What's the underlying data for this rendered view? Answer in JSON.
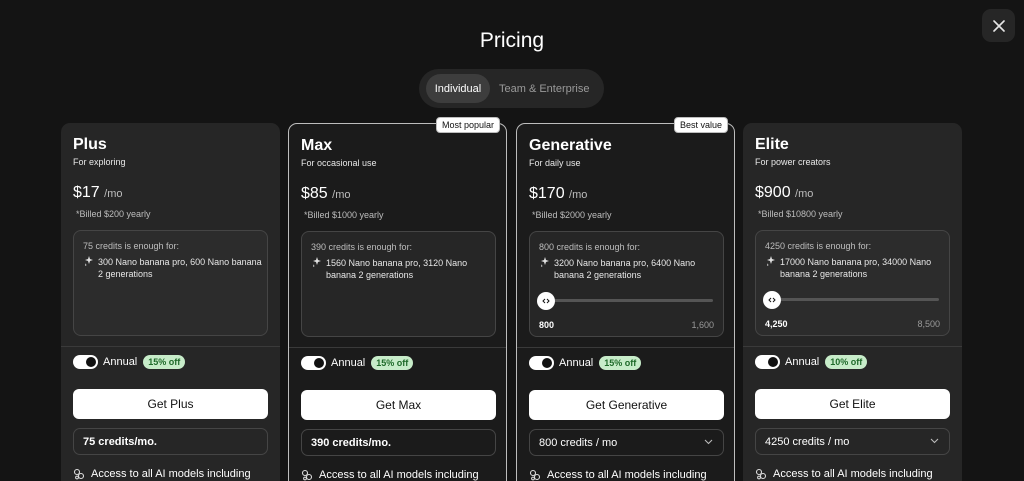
{
  "page": {
    "title": "Pricing",
    "close_icon": "close-icon"
  },
  "tabs": [
    {
      "label": "Individual",
      "active": true
    },
    {
      "label": "Team & Enterprise",
      "active": false
    }
  ],
  "plans": [
    {
      "name": "Plus",
      "subtitle": "For exploring",
      "price": "$17",
      "per": "/mo",
      "billed": "*Billed $200 yearly",
      "badge": "",
      "credits_title": "75 credits is enough for:",
      "credits_text": "300 Nano banana pro, 600 Nano banana 2 generations",
      "slider": null,
      "annual_label": "Annual",
      "discount": "15% off",
      "cta": "Get Plus",
      "credit_field": "75 credits/mo.",
      "dropdown": false,
      "access": "Access to all AI models including"
    },
    {
      "name": "Max",
      "subtitle": "For occasional use",
      "price": "$85",
      "per": "/mo",
      "billed": "*Billed $1000 yearly",
      "badge": "Most popular",
      "credits_title": "390 credits is enough for:",
      "credits_text": "1560 Nano banana pro, 3120 Nano banana 2 generations",
      "slider": null,
      "annual_label": "Annual",
      "discount": "15% off",
      "cta": "Get Max",
      "credit_field": "390 credits/mo.",
      "dropdown": false,
      "access": "Access to all AI models including"
    },
    {
      "name": "Generative",
      "subtitle": "For daily use",
      "price": "$170",
      "per": "/mo",
      "billed": "*Billed $2000 yearly",
      "badge": "Best value",
      "credits_title": "800 credits is enough for:",
      "credits_text": "3200 Nano banana pro, 6400 Nano banana 2 generations",
      "slider": {
        "min": "800",
        "max": "1,600",
        "value": 0
      },
      "annual_label": "Annual",
      "discount": "15% off",
      "cta": "Get Generative",
      "credit_field": "800 credits / mo",
      "dropdown": true,
      "access": "Access to all AI models including"
    },
    {
      "name": "Elite",
      "subtitle": "For power creators",
      "price": "$900",
      "per": "/mo",
      "billed": "*Billed $10800 yearly",
      "badge": "",
      "credits_title": "4250 credits is enough for:",
      "credits_text": "17000 Nano banana pro, 34000 Nano banana 2 generations",
      "slider": {
        "min": "4,250",
        "max": "8,500",
        "value": 0
      },
      "annual_label": "Annual",
      "discount": "10% off",
      "cta": "Get Elite",
      "credit_field": "4250 credits / mo",
      "dropdown": true,
      "access": "Access to all AI models including"
    }
  ],
  "colors": {
    "background": "#141414",
    "card": "#262626",
    "discount_bg": "#c7ecc9",
    "discount_text": "#1f6a2a"
  }
}
